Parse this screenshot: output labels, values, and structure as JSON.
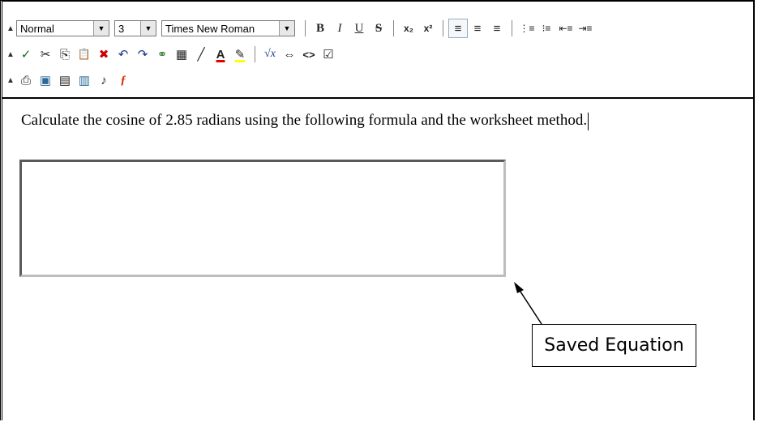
{
  "toolbar": {
    "paragraph_format": "Normal",
    "font_size": "3",
    "font_family": "Times New Roman",
    "row1_buttons": {
      "bold": "B",
      "italic": "I",
      "underline": "U",
      "strike": "S",
      "subscript": "x₂",
      "superscript": "x²",
      "align_left": "≡",
      "align_center": "≡",
      "align_right": "≡",
      "ordered_list": "⋮≡",
      "unordered_list": "⁝≡",
      "outdent": "⇤≡",
      "indent": "⇥≡"
    },
    "row2_icons": [
      "spellcheck-icon",
      "cut-icon",
      "copy-icon",
      "paste-icon",
      "remove-format-icon",
      "undo-icon",
      "redo-icon",
      "link-icon",
      "table-icon",
      "line-icon",
      "font-color-icon",
      "highlight-icon",
      "equation-icon",
      "media-icon",
      "source-code-icon",
      "preview-icon"
    ],
    "row3_icons": [
      "insert-file-icon",
      "insert-image-icon",
      "insert-document-icon",
      "insert-page-icon",
      "insert-audio-icon",
      "insert-flash-icon"
    ],
    "icon_glyphs": {
      "spellcheck": "✓",
      "cut": "✂",
      "copy": "⎘",
      "paste": "📋",
      "remove_format": "✖",
      "undo": "↶",
      "redo": "↷",
      "link": "⚭",
      "table": "▦",
      "line": "╱",
      "font_color": "A",
      "highlight": "✎",
      "equation": "√x",
      "media": "⇔",
      "source": "<>",
      "preview": "☑",
      "file": "⎙",
      "image": "▣",
      "document": "▤",
      "page": "▥",
      "audio": "♪",
      "flash": "ƒ"
    },
    "colors": {
      "font_color_bar": "#e00000",
      "highlight_bar": "#ffff00",
      "flash": "#e03000",
      "equation": "#1a3a8a"
    }
  },
  "editor": {
    "text": "Calculate the cosine of 2.85 radians using the following formula and the worksheet method."
  },
  "annotation": {
    "label": "Saved Equation"
  }
}
